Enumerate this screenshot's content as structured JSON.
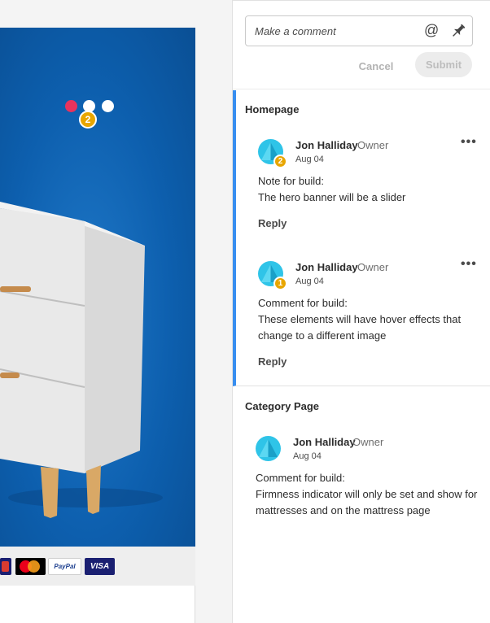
{
  "canvas": {
    "pin_badge_number": "2",
    "payment_icons": [
      "maestro-icon",
      "mastercard-icon",
      "paypal-icon",
      "visa-icon"
    ],
    "paypal_label": "PayPal",
    "visa_label": "VISA",
    "colors": {
      "hero_blue": "#0d5fae",
      "pin_red": "#e8335d",
      "pin_badge": "#e8a600"
    }
  },
  "comment_form": {
    "placeholder": "Make a comment",
    "mention_icon": "@",
    "pin_icon": "pin-icon",
    "cancel_label": "Cancel",
    "submit_label": "Submit"
  },
  "groups": [
    {
      "title": "Homepage",
      "threads": [
        {
          "author": "Jon Halliday",
          "role": "Owner",
          "date": "Aug 04",
          "badge": "2",
          "lines": [
            "Note for build:",
            "The hero banner will be a slider"
          ],
          "reply_label": "Reply"
        },
        {
          "author": "Jon Halliday",
          "role": "Owner",
          "date": "Aug 04",
          "badge": "1",
          "lines": [
            "Comment for build:",
            "These elements will have hover effects that",
            "change to a different image"
          ],
          "reply_label": "Reply"
        }
      ]
    },
    {
      "title": "Category Page",
      "threads": [
        {
          "author": "Jon Halliday",
          "role": "Owner",
          "date": "Aug 04",
          "lines": [
            "Comment for build:",
            "Firmness indicator will only be set and show for",
            "mattresses and on the mattress page"
          ]
        }
      ]
    }
  ],
  "more_menu_glyph": "•••",
  "accent_color": "#378ef0"
}
